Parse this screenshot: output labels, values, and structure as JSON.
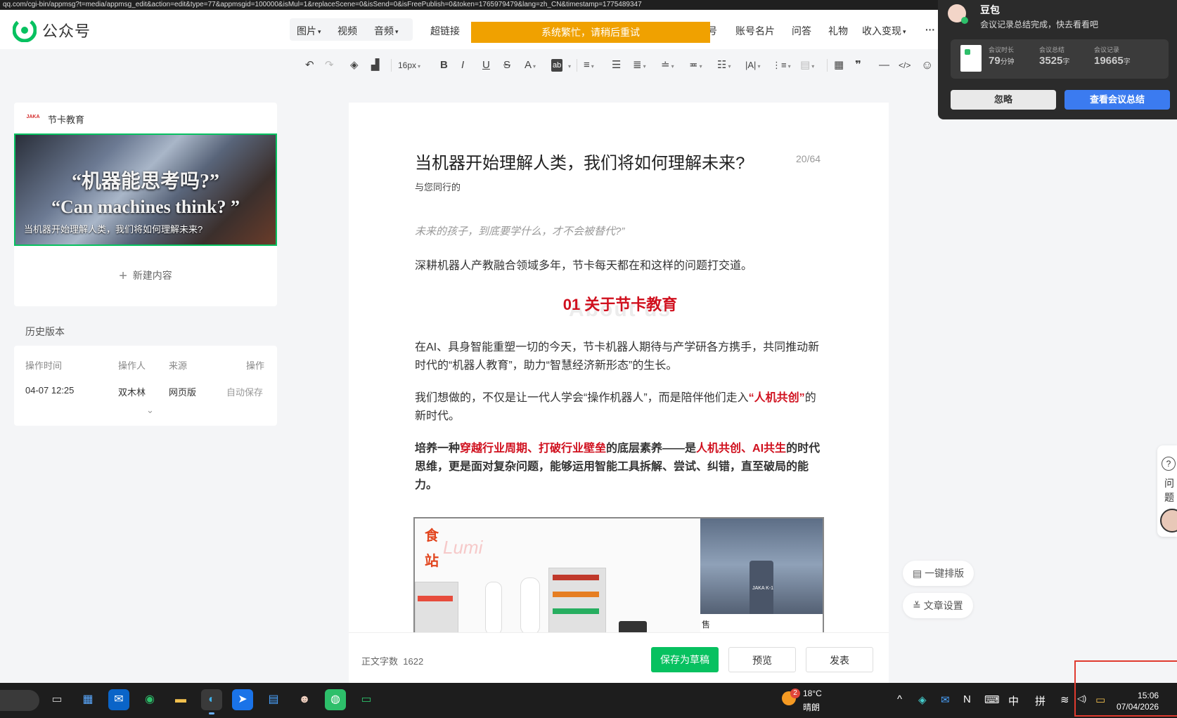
{
  "url_bar": "qq.com/cgi-bin/appmsg?t=media/appmsg_edit&action=edit&type=77&appmsgid=100000&isMul=1&replaceScene=0&isSend=0&isFreePublish=0&token=1765979479&lang=zh_CN&timestamp=1775489347",
  "topnav": {
    "logo_text": "公众号",
    "items": [
      {
        "label": "图片",
        "caret": "▾"
      },
      {
        "label": "视频",
        "caret": ""
      },
      {
        "label": "音频",
        "caret": "▾"
      },
      {
        "label": "超链接",
        "caret": ""
      },
      {
        "label": "号",
        "caret": ""
      },
      {
        "label": "账号名片",
        "caret": ""
      },
      {
        "label": "问答",
        "caret": ""
      },
      {
        "label": "礼物",
        "caret": ""
      },
      {
        "label": "收入变现",
        "caret": "▾"
      },
      {
        "label": "···",
        "caret": ""
      }
    ],
    "busy_banner": "系统繁忙，请稍后重试"
  },
  "toolbar": {
    "font_size": "16px",
    "tools": [
      "↶",
      "↷",
      "◈",
      "▟",
      "B",
      "I",
      "U",
      "S",
      "A",
      "ab",
      "≡",
      "☰",
      "≣",
      "≐",
      "≖",
      "☷",
      "|A|",
      "⋮≡",
      "▤",
      "▦",
      "❞",
      "—",
      "</>",
      "☺"
    ]
  },
  "account": {
    "logo_text": "JAKA",
    "name": "节卡教育"
  },
  "cover": {
    "quote_cn": "“机器能思考吗?”",
    "quote_en": "“Can machines think? ”",
    "caption": "当机器开始理解人类，我们将如何理解未来?"
  },
  "new_content": {
    "plus": "+",
    "label": "新建内容"
  },
  "history": {
    "title": "历史版本",
    "headers": [
      "操作时间",
      "操作人",
      "来源",
      "操作"
    ],
    "rows": [
      {
        "time": "04-07 12:25",
        "operator": "双木林",
        "source": "网页版",
        "action": "自动保存"
      }
    ],
    "expand": "⌄"
  },
  "editor": {
    "title": "当机器开始理解人类，我们将如何理解未来?",
    "title_count": "20/64",
    "author": "与您同行的",
    "quote": "未来的孩子，到底要学什么，才不会被替代?”",
    "p1": "深耕机器人产教融合领域多年，节卡每天都在和这样的问题打交道。",
    "section_ghost": "About us",
    "section_title": "01 关于节卡教育",
    "p2": "在AI、具身智能重塑一切的今天，节卡机器人期待与产学研各方携手，共同推动新时代的“机器人教育”，助力“智慧经济新形态”的生长。",
    "p3_a": "我们想做的，不仅是让一代人学会“操作机器人”，而是陪伴他们走入",
    "p3_red": "“人机共创”",
    "p3_b": "的新时代。",
    "p4_a": "培养一种",
    "p4_red1": "穿越行业周期、打破行业壁垒",
    "p4_b": "的底层素养——是",
    "p4_red2": "人机共创、AI共生",
    "p4_c": "的时代思维，更是面对复杂问题，能够运用智能工具拆解、尝试、纠错，直至破局的能力。",
    "img_text_shi": "食",
    "img_text_zhan": "站",
    "img_text_lumi": "Lumi",
    "img_label": "JAKA K-1",
    "img_caption_char": "售"
  },
  "footer": {
    "word_count_label": "正文字数",
    "word_count": "1622",
    "save_draft": "保存为草稿",
    "preview": "预览",
    "publish": "发表"
  },
  "floating": {
    "layout_btn": "一键排版",
    "settings_btn": "文章设置",
    "help_icon": "?",
    "help_label_1": "问",
    "help_label_2": "题"
  },
  "notification": {
    "app": "豆包",
    "body": "会议记录总结完成，快去看看吧",
    "stats": [
      {
        "label": "会议时长",
        "value": "79",
        "unit": "分钟"
      },
      {
        "label": "会议总结",
        "value": "3525",
        "unit": "字"
      },
      {
        "label": "会议记录",
        "value": "19665",
        "unit": "字"
      }
    ],
    "ignore": "忽略",
    "view": "查看会议总结"
  },
  "taskbar": {
    "apps": [
      "▭",
      "▦",
      "✉",
      "◉",
      "▬",
      "◐",
      "➤",
      "▤",
      "☻",
      "◍",
      "▭"
    ],
    "weather_temp": "18°C",
    "weather_desc": "晴朗",
    "weather_badge": "2",
    "tray": [
      "^",
      "◈",
      "✉",
      "N",
      "⌨",
      "中",
      "拼",
      "≋",
      "◁)",
      "▭"
    ],
    "time": "15:06",
    "date": "07/04/2026"
  },
  "colors": {
    "accent_green": "#07c160",
    "busy_orange": "#f0a100",
    "highlight_red": "#d0101e",
    "notif_blue": "#3b7bf0"
  }
}
